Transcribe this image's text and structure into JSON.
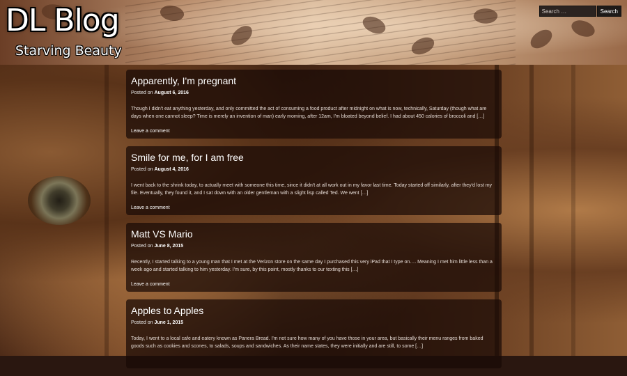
{
  "site": {
    "title": "DL Blog",
    "tagline": "Starving Beauty"
  },
  "search": {
    "placeholder": "Search …",
    "button_label": "Search"
  },
  "colors": {
    "card_background": "#190a06",
    "text": "#ffffff",
    "header_tone": "#b98d6c"
  },
  "posts": [
    {
      "title": "Apparently, I'm pregnant",
      "posted_on_label": "Posted on",
      "date": "August 6, 2016",
      "excerpt": "Though I didn't eat anything yesterday, and only committed the act of consuming a food product after midnight on what is now, technically, Saturday (though what are days when one cannot sleep? Time is merely an invention of man) early morning, after 12am, I'm bloated beyond belief. I had about 450 calories of broccoli and […]",
      "comment_link": "Leave a comment"
    },
    {
      "title": "Smile for me, for I am free",
      "posted_on_label": "Posted on",
      "date": "August 4, 2016",
      "excerpt": "I went back to the shrink today, to actually meet with someone this time, since it didn't at all work out in my favor last time. Today started off similarly, after they'd lost my file. Eventually, they found it, and I sat down with an older gentleman with a slight lisp called Ted. We went […]",
      "comment_link": "Leave a comment"
    },
    {
      "title": "Matt VS Mario",
      "posted_on_label": "Posted on",
      "date": "June 8, 2015",
      "excerpt": "Recently, I started talking to a young man that I met at the Verizon store on the same day I purchased this very iPad that I type on…. Meaning I met him little less than a week ago and started talking to him yesterday. I'm sure, by this point, mostly thanks to our texting this […]",
      "comment_link": "Leave a comment"
    },
    {
      "title": "Apples to Apples",
      "posted_on_label": "Posted on",
      "date": "June 1, 2015",
      "excerpt": "Today, I went to a local cafe and eatery known as Panera Bread. I'm not sure how many of you have those in your area, but basically their menu ranges from baked goods such as cookies and scones, to salads, soups and sandwiches. As their name states, they were initially and are still, to some […]",
      "comment_link": ""
    }
  ]
}
